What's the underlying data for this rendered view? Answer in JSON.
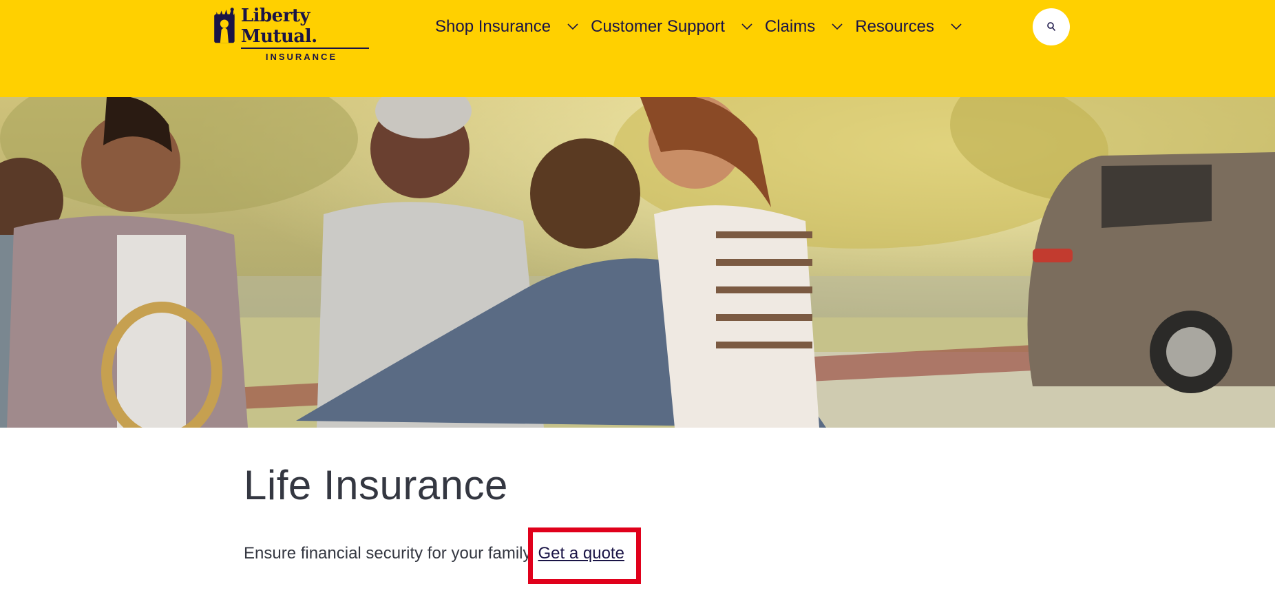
{
  "brand": {
    "name": "Liberty Mutual.",
    "sub": "INSURANCE",
    "colors": {
      "primary_yellow": "#ffd000",
      "navy": "#1a1446",
      "highlight_red": "#e0001b"
    }
  },
  "nav": {
    "items": [
      {
        "label": "Shop Insurance",
        "icon": "chevron-down-icon"
      },
      {
        "label": "Customer Support",
        "icon": "chevron-down-icon"
      },
      {
        "label": "Claims",
        "icon": "chevron-down-icon"
      },
      {
        "label": "Resources",
        "icon": "chevron-down-icon"
      }
    ],
    "search_icon": "search-icon"
  },
  "hero": {
    "image": "family-outdoors-photo"
  },
  "main": {
    "title": "Life Insurance",
    "tagline": "Ensure financial security for your family",
    "cta_label": "Get a quote"
  }
}
